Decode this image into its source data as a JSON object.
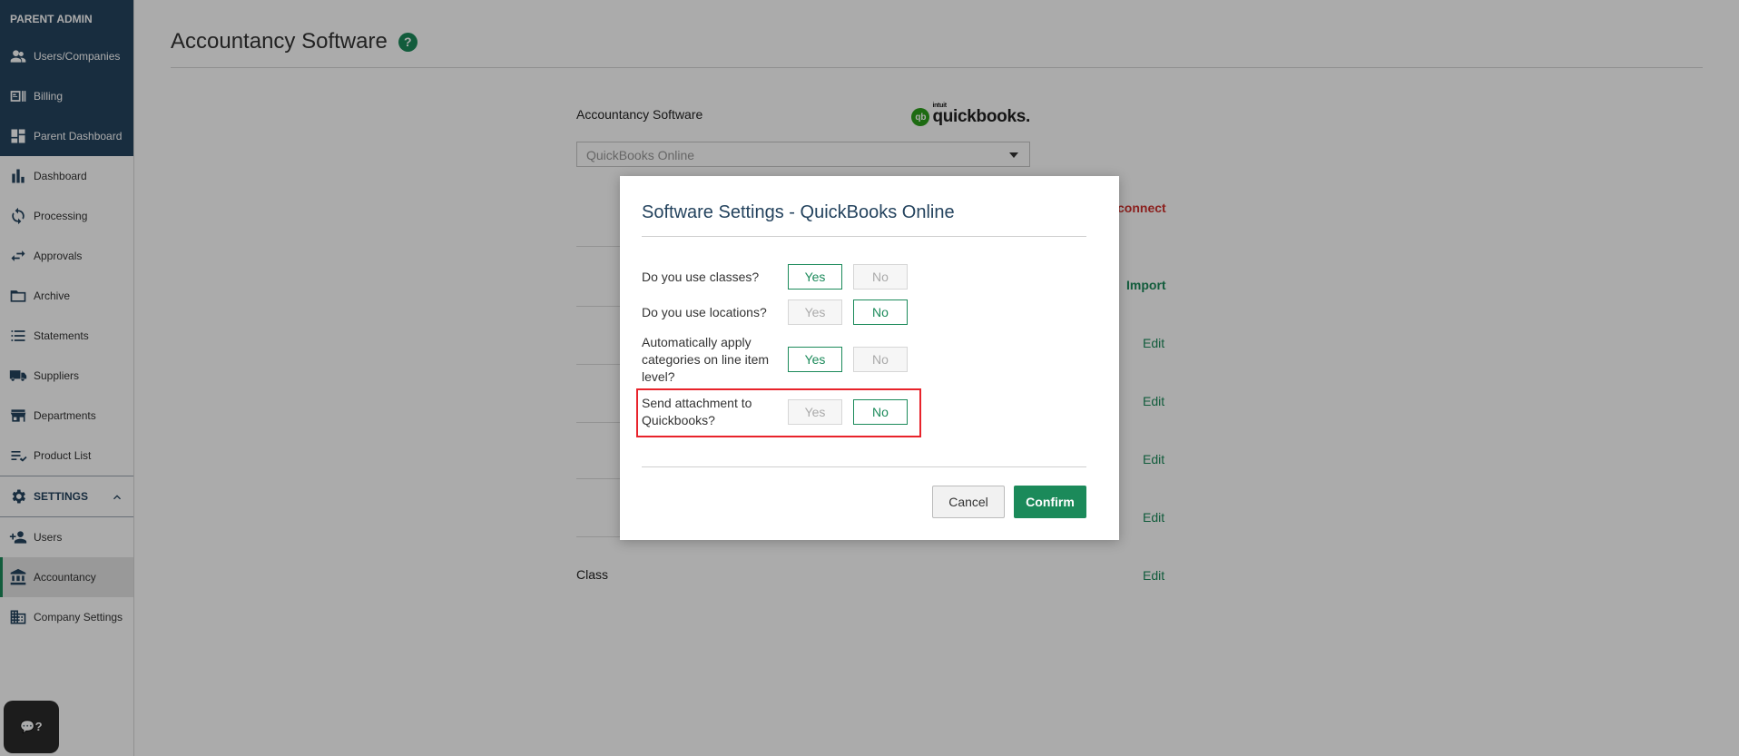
{
  "sidebar": {
    "admin_title": "PARENT ADMIN",
    "admin_items": [
      {
        "label": "Users/Companies",
        "icon": "users-icon"
      },
      {
        "label": "Billing",
        "icon": "billing-icon"
      },
      {
        "label": "Parent Dashboard",
        "icon": "dashboard-grid-icon"
      }
    ],
    "main_items": [
      {
        "label": "Dashboard",
        "icon": "bar-chart-icon"
      },
      {
        "label": "Processing",
        "icon": "sync-icon"
      },
      {
        "label": "Approvals",
        "icon": "swap-arrows-icon"
      },
      {
        "label": "Archive",
        "icon": "folder-icon"
      },
      {
        "label": "Statements",
        "icon": "list-icon"
      },
      {
        "label": "Suppliers",
        "icon": "truck-icon"
      },
      {
        "label": "Departments",
        "icon": "store-icon"
      },
      {
        "label": "Product List",
        "icon": "checklist-icon"
      }
    ],
    "settings_label": "SETTINGS",
    "settings_items": [
      {
        "label": "Users",
        "icon": "add-user-icon"
      },
      {
        "label": "Accountancy",
        "icon": "bank-icon",
        "active": true
      },
      {
        "label": "Company Settings",
        "icon": "building-icon"
      }
    ],
    "help_widget": "💬?"
  },
  "page": {
    "title": "Accountancy Software",
    "help_icon": "?",
    "software_label": "Accountancy Software",
    "logo_intuit": "intuit",
    "logo_text": "quickbooks.",
    "logo_mark": "qb",
    "select_value": "QuickBooks Online",
    "connect_text": "connect",
    "import_text": "Import",
    "edit_label": "Edit",
    "class_label": "Class"
  },
  "modal": {
    "title": "Software Settings - QuickBooks Online",
    "questions": [
      {
        "label": "Do you use classes?",
        "yes": "Yes",
        "no": "No",
        "selected": "Yes"
      },
      {
        "label": "Do you use locations?",
        "yes": "Yes",
        "no": "No",
        "selected": "No"
      },
      {
        "label": "Automatically apply categories on line item level?",
        "yes": "Yes",
        "no": "No",
        "selected": "Yes"
      },
      {
        "label": "Send attachment to Quickbooks?",
        "yes": "Yes",
        "no": "No",
        "selected": "No"
      }
    ],
    "cancel_label": "Cancel",
    "confirm_label": "Confirm"
  },
  "colors": {
    "brand_navy": "#24435e",
    "brand_green": "#1b8a5a",
    "danger_red": "#d0312d",
    "highlight_red": "#e8232b"
  }
}
